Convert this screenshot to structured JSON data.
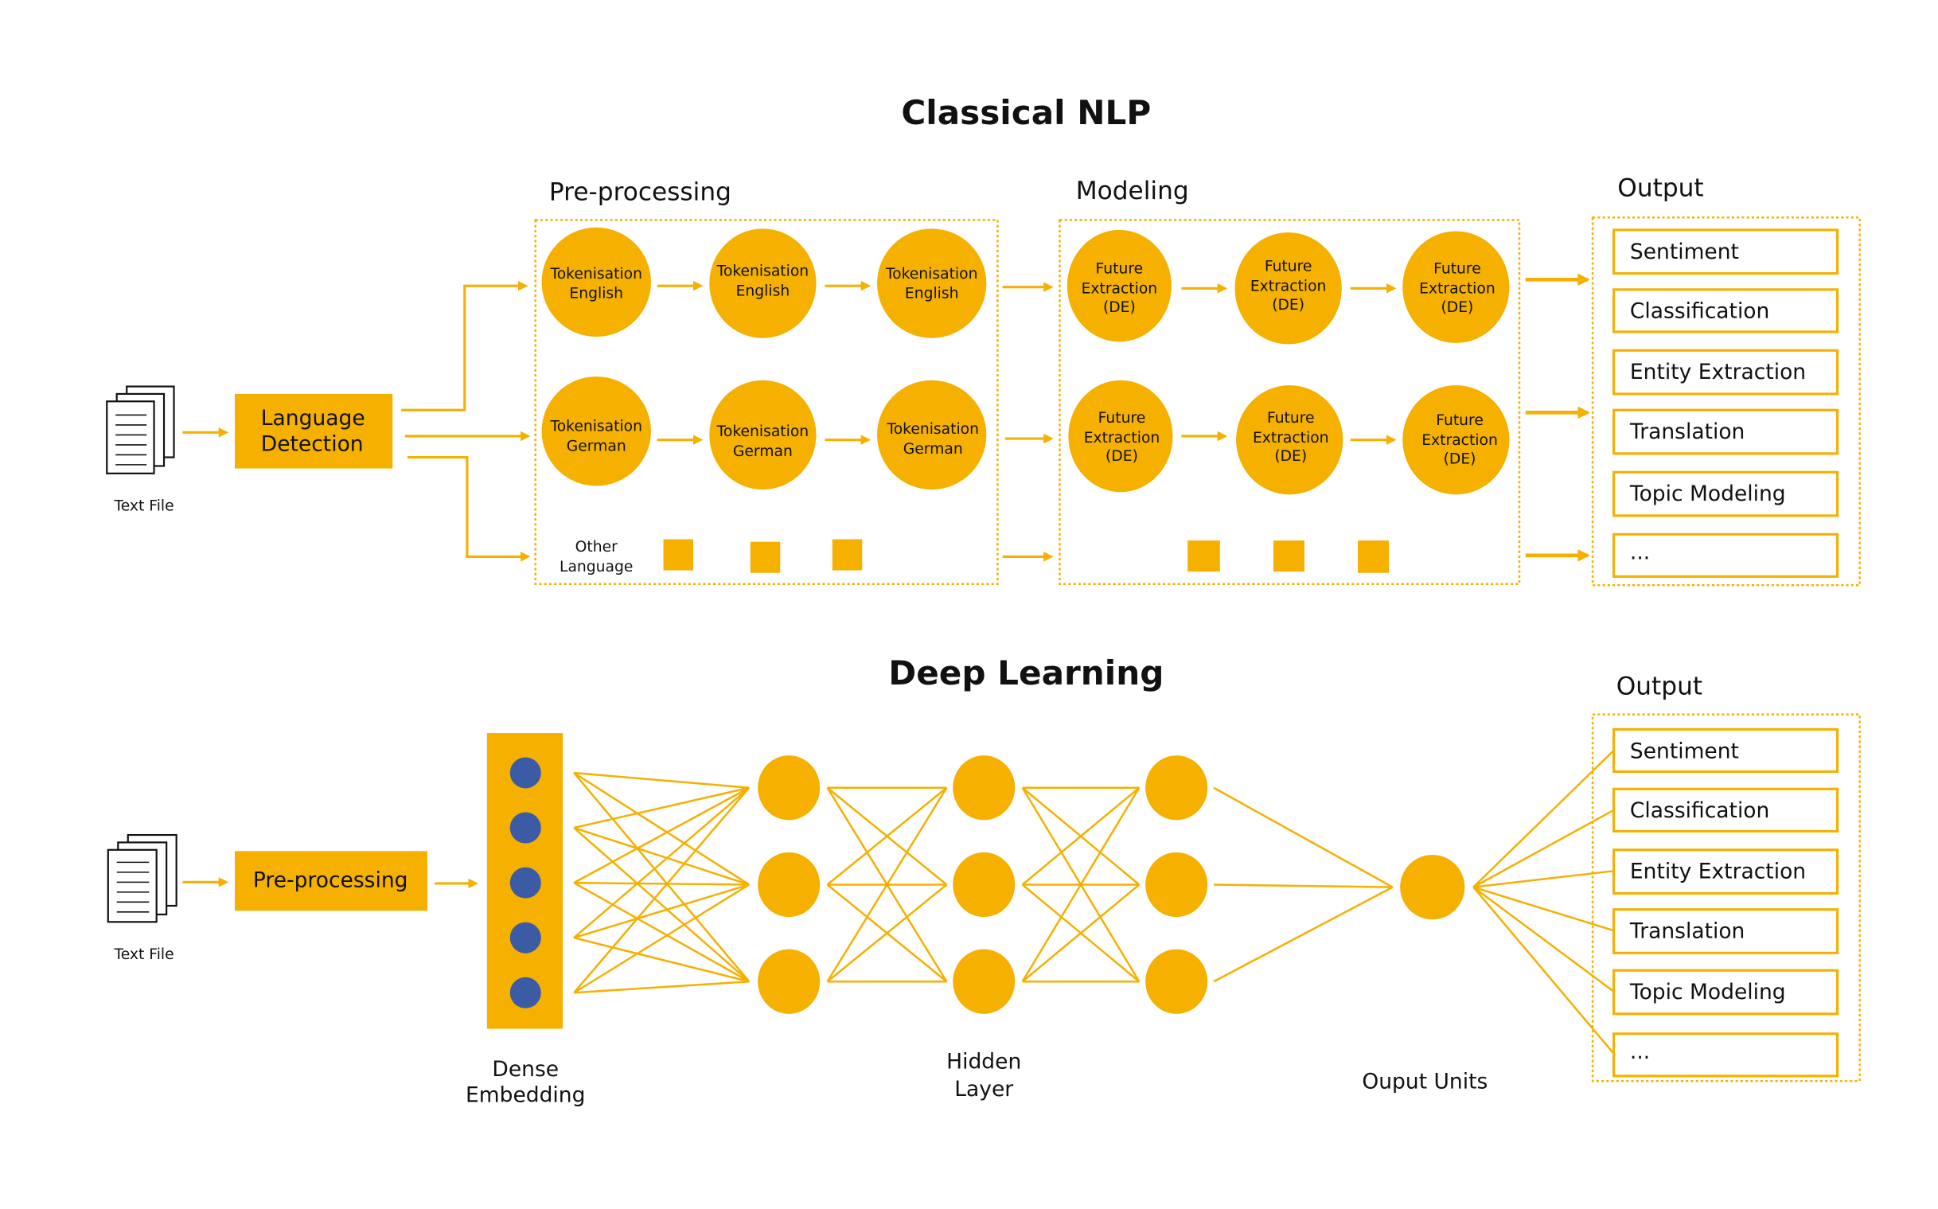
{
  "colors": {
    "accent": "#F5B000",
    "embedding_dot": "#3B5BA5",
    "text": "#111111",
    "background": "#FFFFFF"
  },
  "classical": {
    "title": "Classical NLP",
    "input": {
      "icon": "document-stack-icon",
      "label": "Text File"
    },
    "language_detection": {
      "line1": "Language",
      "line2": "Detection"
    },
    "preprocessing": {
      "label": "Pre-processing",
      "rows": [
        {
          "nodes": [
            {
              "line1": "Tokenisation",
              "line2": "English"
            },
            {
              "line1": "Tokenisation",
              "line2": "English"
            },
            {
              "line1": "Tokenisation",
              "line2": "English"
            }
          ]
        },
        {
          "nodes": [
            {
              "line1": "Tokenisation",
              "line2": "German"
            },
            {
              "line1": "Tokenisation",
              "line2": "German"
            },
            {
              "line1": "Tokenisation",
              "line2": "German"
            }
          ]
        }
      ],
      "other": {
        "line1": "Other",
        "line2": "Language",
        "placeholder_count": 3
      }
    },
    "modeling": {
      "label": "Modeling",
      "rows": [
        {
          "nodes": [
            {
              "line1": "Future",
              "line2": "Extraction",
              "line3": "(DE)"
            },
            {
              "line1": "Future",
              "line2": "Extraction",
              "line3": "(DE)"
            },
            {
              "line1": "Future",
              "line2": "Extraction",
              "line3": "(DE)"
            }
          ]
        },
        {
          "nodes": [
            {
              "line1": "Future",
              "line2": "Extraction",
              "line3": "(DE)"
            },
            {
              "line1": "Future",
              "line2": "Extraction",
              "line3": "(DE)"
            },
            {
              "line1": "Future",
              "line2": "Extraction",
              "line3": "(DE)"
            }
          ]
        }
      ],
      "placeholder_count": 3
    },
    "output": {
      "label": "Output",
      "items": [
        "Sentiment",
        "Classification",
        "Entity Extraction",
        "Translation",
        "Topic Modeling",
        "..."
      ]
    }
  },
  "deep": {
    "title": "Deep Learning",
    "input": {
      "icon": "document-stack-icon",
      "label": "Text File"
    },
    "preprocessing": {
      "label": "Pre-processing"
    },
    "embedding": {
      "line1": "Dense",
      "line2": "Embedding",
      "units": 5
    },
    "hidden": {
      "line1": "Hidden",
      "line2": "Layer",
      "layers": 3,
      "units_per_layer": 3
    },
    "output_units": {
      "label": "Ouput Units",
      "units": 1
    },
    "output": {
      "label": "Output",
      "items": [
        "Sentiment",
        "Classification",
        "Entity Extraction",
        "Translation",
        "Topic Modeling",
        "..."
      ]
    }
  }
}
